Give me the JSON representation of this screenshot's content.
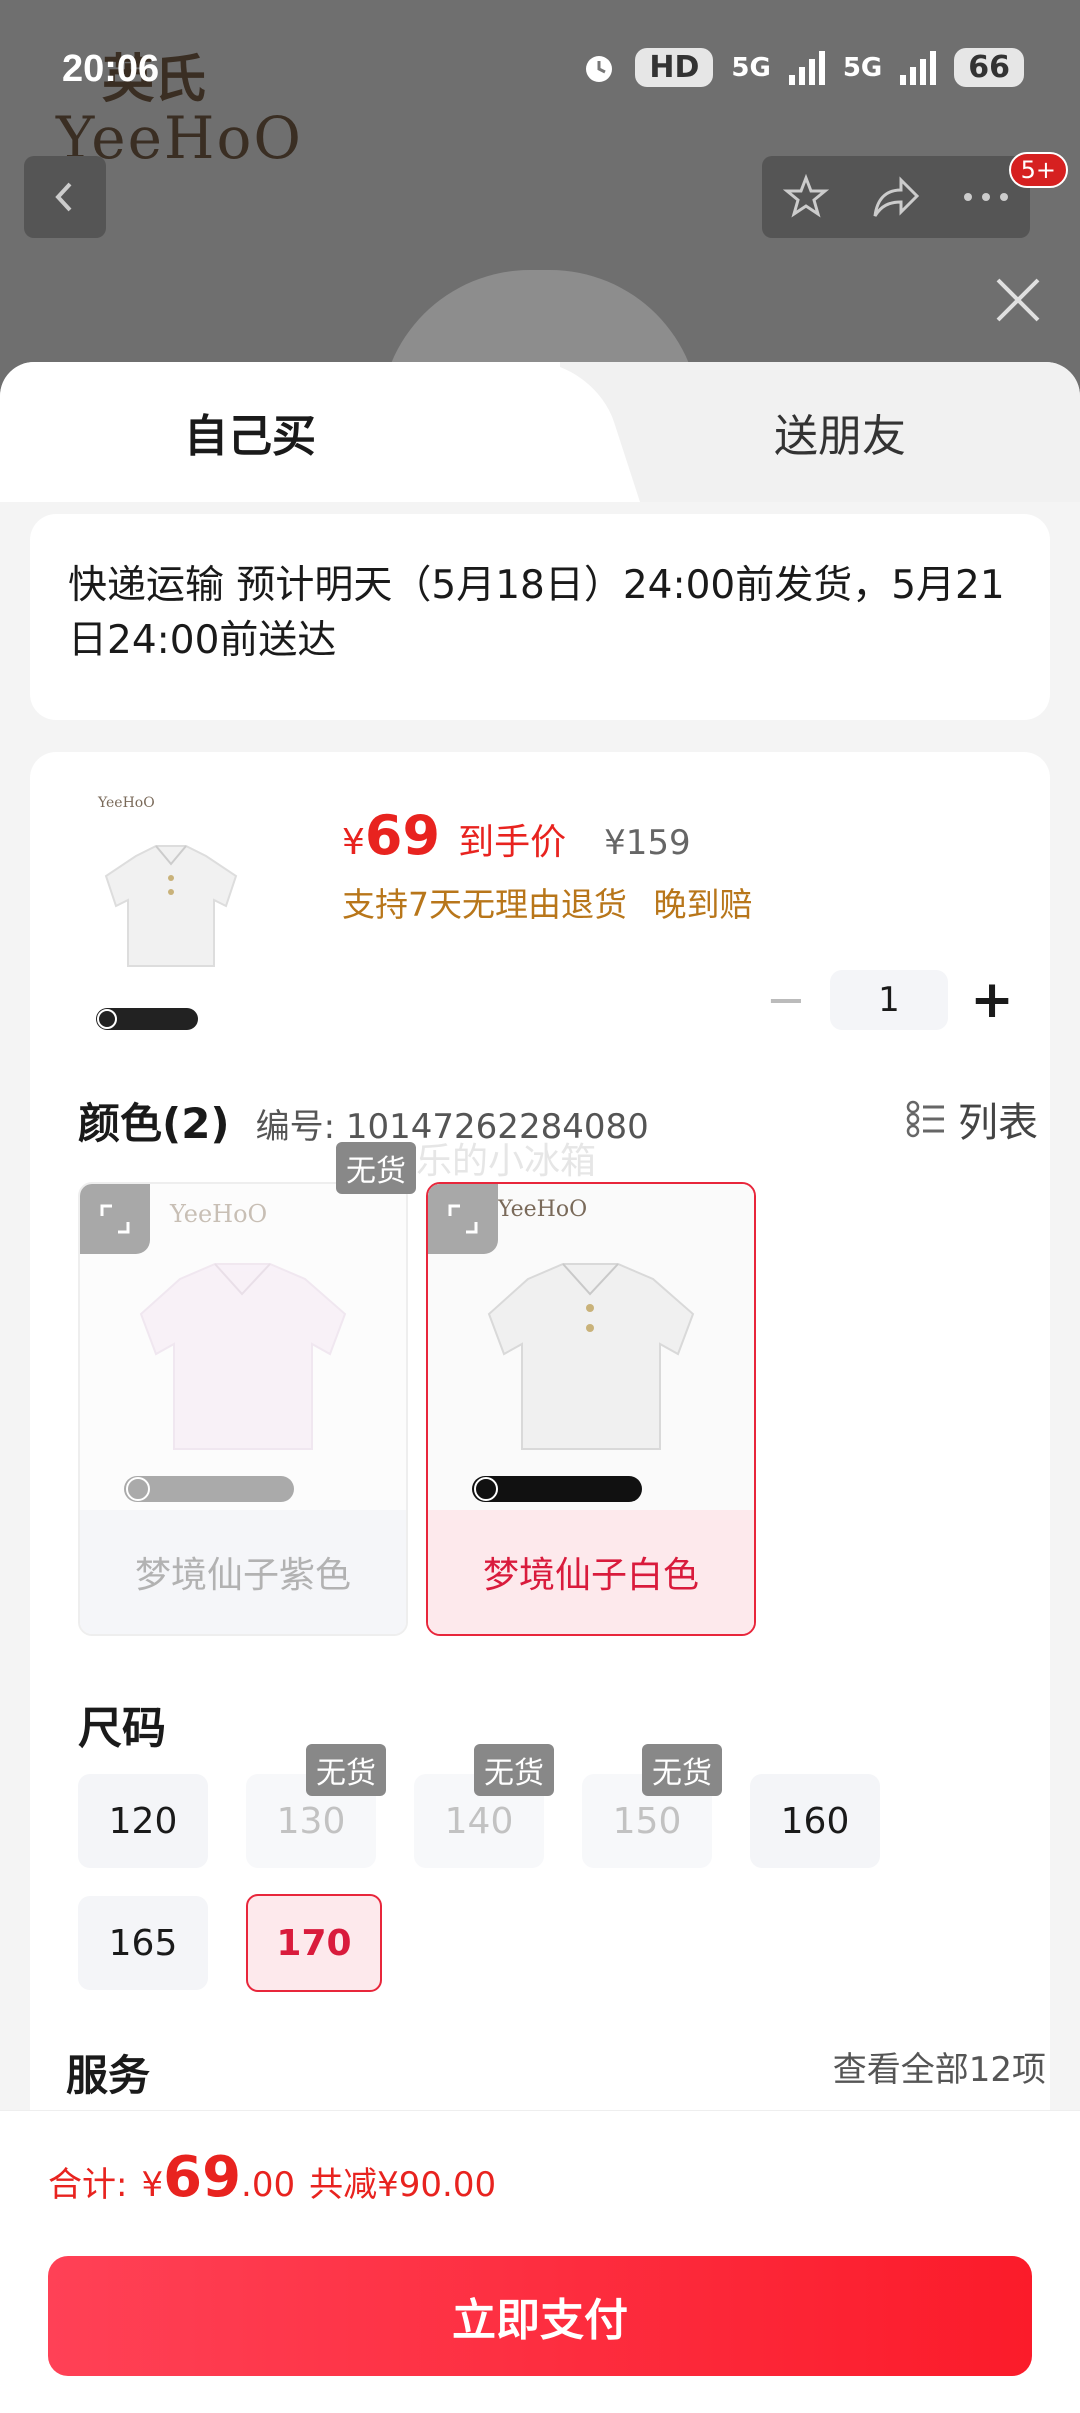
{
  "status_bar": {
    "time": "20:06",
    "battery": "66",
    "network1": "5G",
    "network2": "5G",
    "hd": "HD"
  },
  "brand": {
    "logo_cn": "英氏",
    "logo_en": "YeeHoO"
  },
  "header": {
    "badge": "5+"
  },
  "tabs": {
    "self": "自己买",
    "friend": "送朋友"
  },
  "delivery": {
    "text": "快递运输 预计明天（5月18日）24:00前发货，5月21日24:00前送达"
  },
  "product": {
    "price_symbol": "¥",
    "price": "69",
    "price_label": "到手价",
    "original_price": "¥159",
    "promises": [
      "支持7天无理由退货",
      "晚到赔"
    ],
    "quantity": "1",
    "thumb_logo": "YeeHoO"
  },
  "color": {
    "title": "颜色(2)",
    "code": "编号: 10147262284080",
    "list_toggle": "列表",
    "watermark": "快乐的小冰箱",
    "options": [
      {
        "label": "梦境仙子紫色",
        "tag": "无货",
        "status": "out_of_stock",
        "logo": "YeeHoO"
      },
      {
        "label": "梦境仙子白色",
        "status": "selected",
        "logo": "YeeHoO"
      }
    ]
  },
  "size": {
    "title": "尺码",
    "oos_tag": "无货",
    "options": [
      {
        "label": "120",
        "status": "available"
      },
      {
        "label": "130",
        "status": "out_of_stock"
      },
      {
        "label": "140",
        "status": "out_of_stock"
      },
      {
        "label": "150",
        "status": "out_of_stock"
      },
      {
        "label": "160",
        "status": "available"
      },
      {
        "label": "165",
        "status": "available"
      },
      {
        "label": "170",
        "status": "selected"
      }
    ]
  },
  "service": {
    "title": "服务",
    "more": "查看全部12项"
  },
  "footer": {
    "total_label": "合计:",
    "total_symbol": "¥",
    "total_int": "69",
    "total_dec": ".00",
    "discount": "共减¥90.00",
    "pay_button": "立即支付"
  },
  "colors": {
    "accent": "#e8231f",
    "promise": "#b8761a",
    "selected_bg": "#fde9ec"
  }
}
